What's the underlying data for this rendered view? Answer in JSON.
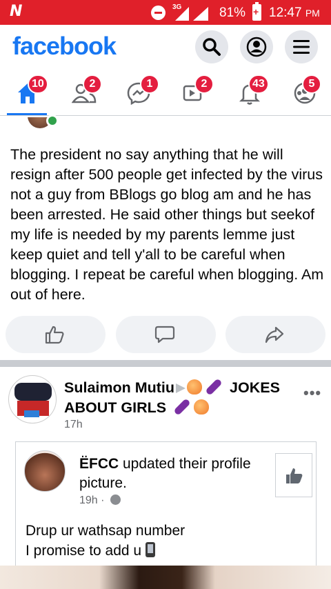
{
  "status_bar": {
    "app_logo": "N",
    "network": "3G",
    "battery_percent": "81%",
    "time": "12:47",
    "ampm": "PM",
    "colors": {
      "background": "#e0202a"
    }
  },
  "header": {
    "logo": "facebook",
    "icons": [
      "search-icon",
      "profile-icon",
      "menu-icon"
    ],
    "colors": {
      "brand": "#1877f2",
      "button_bg": "#e4e6eb"
    }
  },
  "tabs": [
    {
      "name": "home",
      "badge": "10",
      "active": true
    },
    {
      "name": "friends",
      "badge": "2"
    },
    {
      "name": "messenger",
      "badge": "1"
    },
    {
      "name": "watch",
      "badge": "2"
    },
    {
      "name": "notifications",
      "badge": "43"
    },
    {
      "name": "groups",
      "badge": "5"
    }
  ],
  "post1": {
    "text": "The president no say anything that he will resign after 500 people get infected by the virus not a guy from BBlogs go blog am and he has been arrested. He said other things but seekof my life is needed by my parents lemme just keep quiet and tell y'all to be careful when blogging. I repeat be careful when blogging. Am out of here.",
    "actions": [
      "like-icon",
      "comment-icon",
      "share-icon"
    ]
  },
  "post2": {
    "author": "Sulaimon Mutiu",
    "group_part1": "JOKES",
    "group_part2": "ABOUT GIRLS",
    "time": "17h",
    "more": "•••",
    "shared": {
      "page_name": "ËFCC",
      "action": " updated their profile picture.",
      "time": "19h",
      "separator": "·",
      "body_line1": "Drup ur wathsap number",
      "body_line2": "I promise to add u"
    }
  }
}
